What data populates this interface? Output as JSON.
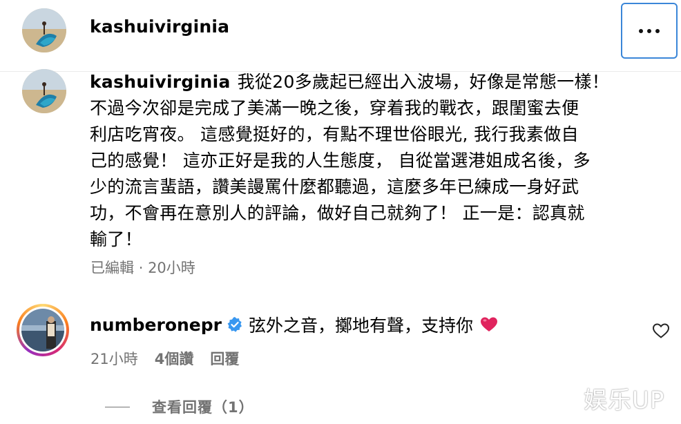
{
  "post": {
    "author": "kashuivirginia",
    "more_icon": "more-horizontal-icon",
    "accent_border": "#3a86d8"
  },
  "caption": {
    "username": "kashuivirginia",
    "lines": [
      "我從20多歲起已經出入波場，好像是常態一樣！",
      "不過今次卻是完成了美滿一晚之後，穿着我的戰衣，跟閨蜜去便",
      "利店吃宵夜。 這感覺挺好的，有點不理世俗眼光, 我行我素做自",
      "己的感覺！ 這亦正好是我的人生態度， 自從當選港姐成名後，多",
      "少的流言蜚語，讚美謾罵什麼都聽過，這麼多年已練成一身好武",
      "功，不會再在意別人的評論，做好自己就夠了！ 正一是：認真就",
      "輸了！"
    ],
    "edited": "已編輯",
    "separator": "·",
    "time": "20小時"
  },
  "comment": {
    "username": "numberonepr",
    "verified_icon": "verified-badge-icon",
    "text": "弦外之音，擲地有聲，支持你",
    "emoji": "❤️",
    "time": "21小時",
    "likes": "4個讚",
    "reply_label": "回覆",
    "like_icon": "heart-outline-icon",
    "view_replies": "查看回覆（1）"
  },
  "watermark": "娱乐UP",
  "colors": {
    "secondary_text": "#737373",
    "verified_blue": "#3897f0",
    "heart_red": "#e0245e"
  }
}
